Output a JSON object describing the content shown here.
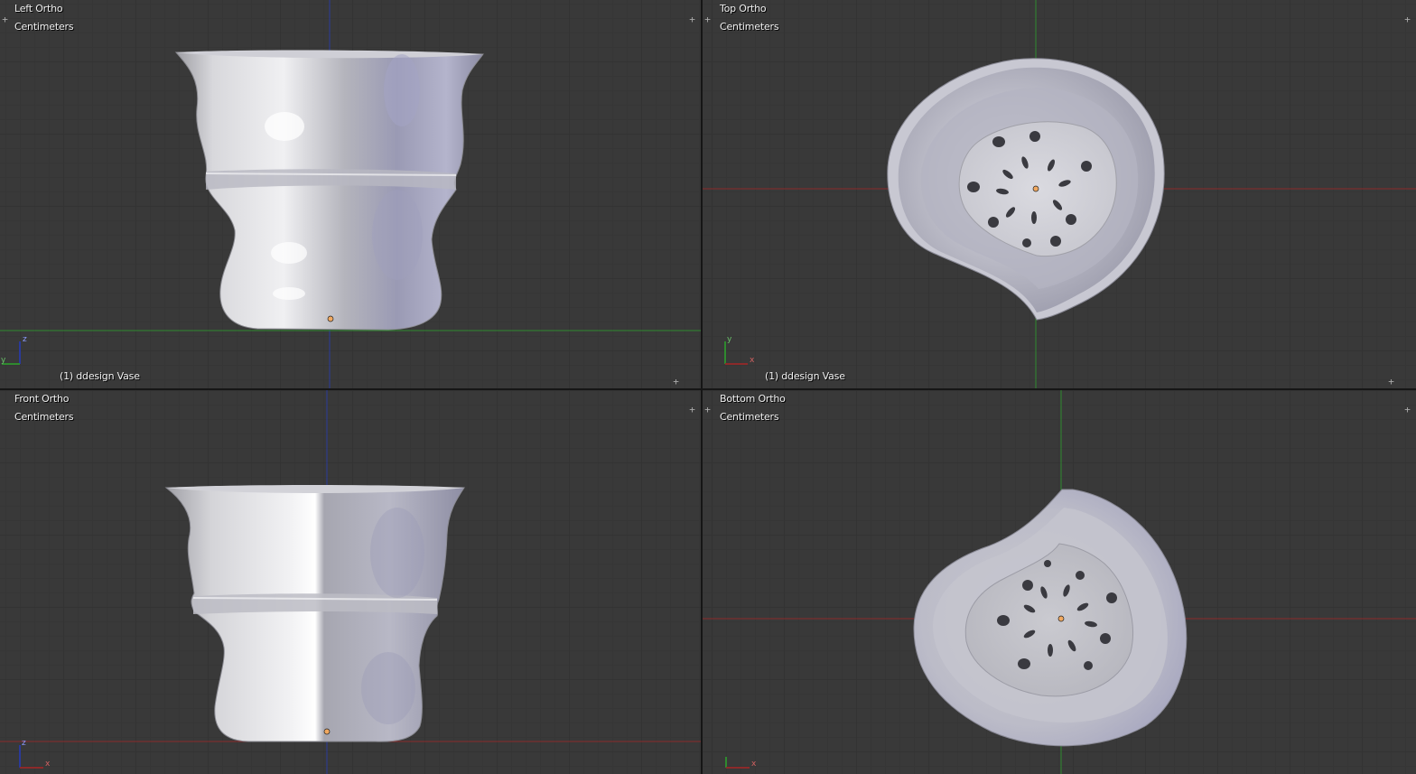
{
  "viewports": {
    "top_left": {
      "view_name": "Left Ortho",
      "units": "Centimeters",
      "object_label": "(1) ddesign Vase",
      "axis_vertical": "z",
      "axis_horizontal": "y"
    },
    "top_right": {
      "view_name": "Top Ortho",
      "units": "Centimeters",
      "object_label": "(1) ddesign Vase",
      "axis_vertical": "y",
      "axis_horizontal": "x"
    },
    "bottom_left": {
      "view_name": "Front Ortho",
      "units": "Centimeters",
      "axis_vertical": "z",
      "axis_horizontal": "x"
    },
    "bottom_right": {
      "view_name": "Bottom Ortho",
      "units": "Centimeters",
      "axis_vertical": "y",
      "axis_horizontal": "x"
    }
  },
  "colors": {
    "background": "#393939",
    "grid_line": "#333333",
    "axis_x": "#8c2a2a",
    "axis_y": "#2f8a2f",
    "axis_z": "#2a3a9a",
    "origin_point": "#f0a860",
    "mesh_light": "#e4e4ea",
    "mesh_mid": "#b8b8c0",
    "mesh_dark": "#8a8aa0",
    "text": "#f2f2f2"
  }
}
